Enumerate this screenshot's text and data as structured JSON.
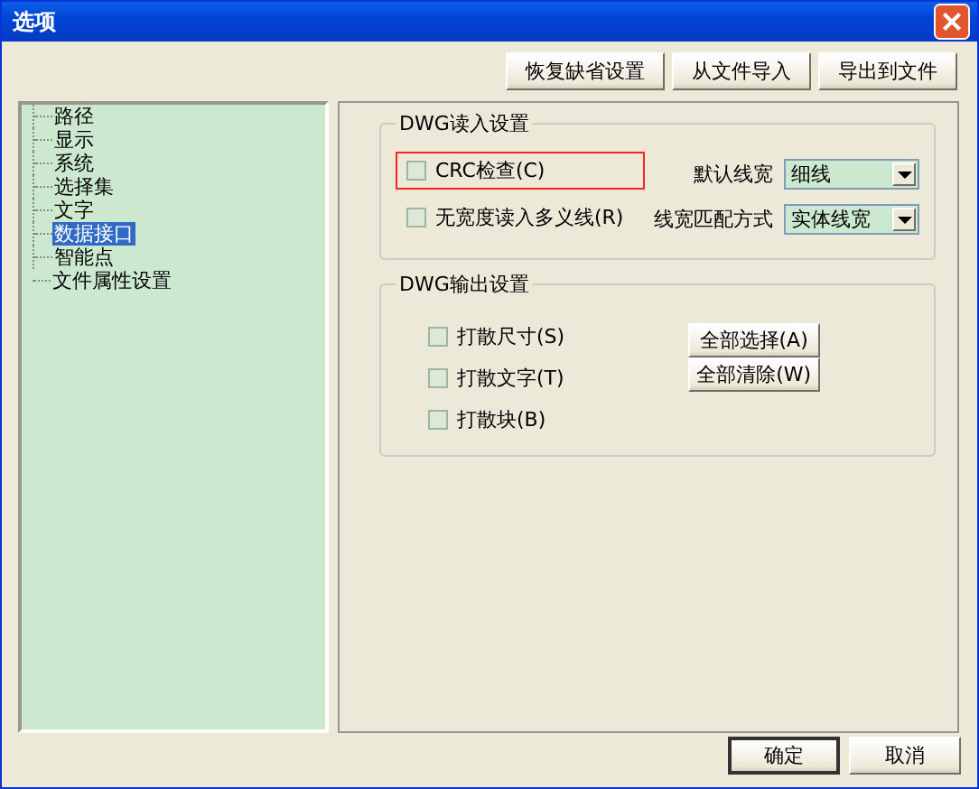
{
  "window": {
    "title": "选项"
  },
  "toolbar_buttons": [
    "恢复缺省设置",
    "从文件导入",
    "导出到文件"
  ],
  "tree": {
    "items": [
      {
        "label": "路径",
        "selected": false
      },
      {
        "label": "显示",
        "selected": false
      },
      {
        "label": "系统",
        "selected": false
      },
      {
        "label": "选择集",
        "selected": false
      },
      {
        "label": "文字",
        "selected": false
      },
      {
        "label": "数据接口",
        "selected": true
      },
      {
        "label": "智能点",
        "selected": false
      },
      {
        "label": "文件属性设置",
        "selected": false
      }
    ]
  },
  "read_settings": {
    "title": "DWG读入设置",
    "checkboxes": [
      {
        "label": "CRC检查(C)",
        "checked": false,
        "highlighted": true
      },
      {
        "label": "无宽度读入多义线(R)",
        "checked": false,
        "highlighted": false
      }
    ],
    "dropdowns": [
      {
        "label": "默认线宽",
        "value": "细线"
      },
      {
        "label": "线宽匹配方式",
        "value": "实体线宽"
      }
    ]
  },
  "write_settings": {
    "title": "DWG输出设置",
    "checkboxes": [
      {
        "label": "打散尺寸(S)",
        "checked": false
      },
      {
        "label": "打散文字(T)",
        "checked": false
      },
      {
        "label": "打散块(B)",
        "checked": false
      }
    ],
    "buttons": [
      "全部选择(A)",
      "全部清除(W)"
    ]
  },
  "dialog_buttons": [
    {
      "label": "确定",
      "default": true
    },
    {
      "label": "取消",
      "default": false
    }
  ]
}
